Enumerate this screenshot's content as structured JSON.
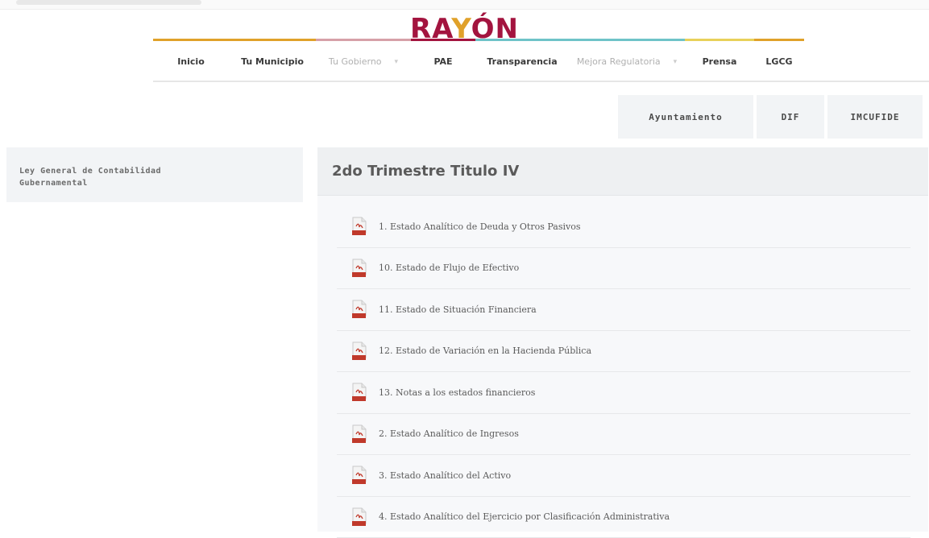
{
  "brand": {
    "logo_text_1": "RA",
    "logo_text_2": "Y",
    "logo_text_3": "ÓN",
    "accent_color": "#a3143f",
    "secondary_color": "#e0a12a"
  },
  "nav": {
    "items": [
      {
        "label": "Inicio",
        "muted": false,
        "dropdown": false
      },
      {
        "label": "Tu Municipio",
        "muted": false,
        "dropdown": false
      },
      {
        "label": "Tu Gobierno",
        "muted": true,
        "dropdown": true
      },
      {
        "label": "PAE",
        "muted": false,
        "dropdown": false
      },
      {
        "label": "Transparencia",
        "muted": false,
        "dropdown": false
      },
      {
        "label": "Mejora Regulatoria",
        "muted": true,
        "dropdown": true
      },
      {
        "label": "Prensa",
        "muted": false,
        "dropdown": false
      },
      {
        "label": "LGCG",
        "muted": false,
        "dropdown": false
      }
    ]
  },
  "subnav": {
    "items": [
      "Ayuntamiento",
      "DIF",
      "IMCUFIDE"
    ]
  },
  "sidebar": {
    "line1": "Ley General de Contabilidad",
    "line2": "Gubernamental"
  },
  "panel": {
    "title": "2do Trimestre Titulo IV",
    "documents": [
      "1. Estado Analítico de Deuda y Otros Pasivos",
      "10. Estado de Flujo de Efectivo",
      "11. Estado de Situación Financiera",
      "12. Estado de Variación en la Hacienda Pública",
      "13. Notas a los estados financieros",
      "2. Estado Analítico de Ingresos",
      "3. Estado Analítico del Activo",
      "4. Estado Analítico del Ejercicio por Clasificación Administrativa"
    ]
  },
  "icons": {
    "document_icon": "pdf-file-icon",
    "dropdown_icon": "chevron-down-icon"
  }
}
